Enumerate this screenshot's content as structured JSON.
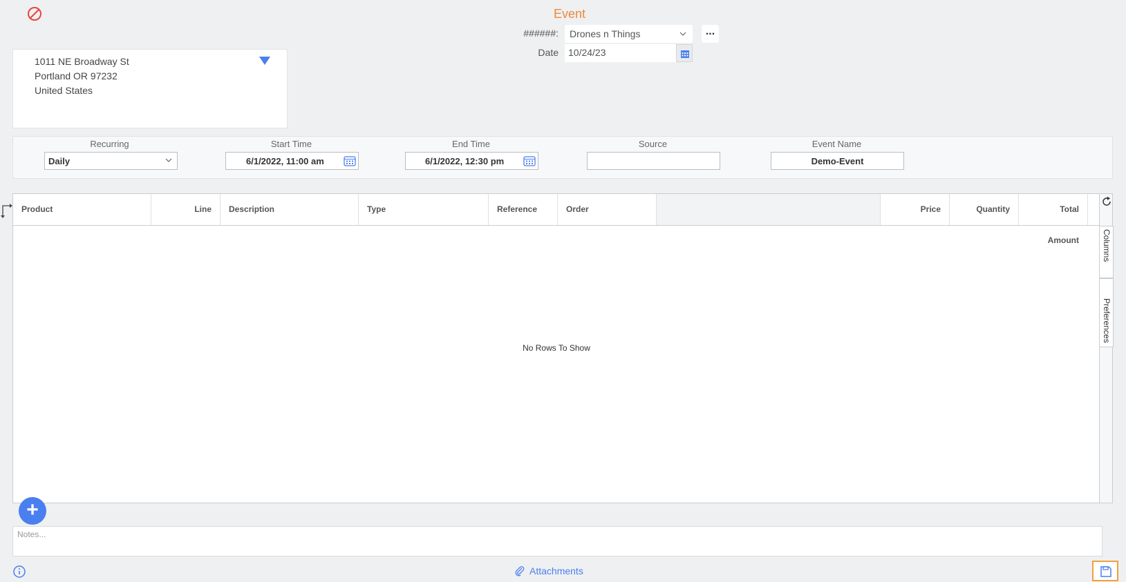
{
  "header": {
    "title": "Event",
    "customer_label": "######:",
    "customer_value": "Drones n Things",
    "more_label": "...",
    "date_label": "Date",
    "date_value": "10/24/23"
  },
  "address": {
    "lines": [
      "1011 NE Broadway St",
      "Portland OR 97232",
      "United States"
    ]
  },
  "fields": {
    "recurring": {
      "label": "Recurring",
      "value": "Daily"
    },
    "start_time": {
      "label": "Start Time",
      "value": "6/1/2022, 11:00 am"
    },
    "end_time": {
      "label": "End Time",
      "value": "6/1/2022, 12:30 pm"
    },
    "source": {
      "label": "Source",
      "value": ""
    },
    "event_name": {
      "label": "Event Name",
      "value": "Demo-Event"
    }
  },
  "grid": {
    "columns": [
      "Product",
      "Line",
      "Description",
      "Type",
      "Reference",
      "Order",
      "Price",
      "Quantity",
      "Total Amount"
    ],
    "empty_message": "No Rows To Show",
    "side_tabs": [
      "Columns",
      "Preferences"
    ]
  },
  "notes": {
    "placeholder": "Notes..."
  },
  "footer": {
    "attachments_label": "Attachments"
  },
  "colors": {
    "accent": "#4a7ff0",
    "title": "#f0873a",
    "cancel": "#e8453c",
    "save_border": "#f0a040"
  },
  "icons": [
    "cancel-icon",
    "chevron-down-icon",
    "calendar-icon",
    "caret-down-icon",
    "refresh-icon",
    "columns-icon",
    "split-arrow-icon",
    "plus-icon",
    "info-icon",
    "paperclip-icon",
    "save-icon"
  ]
}
